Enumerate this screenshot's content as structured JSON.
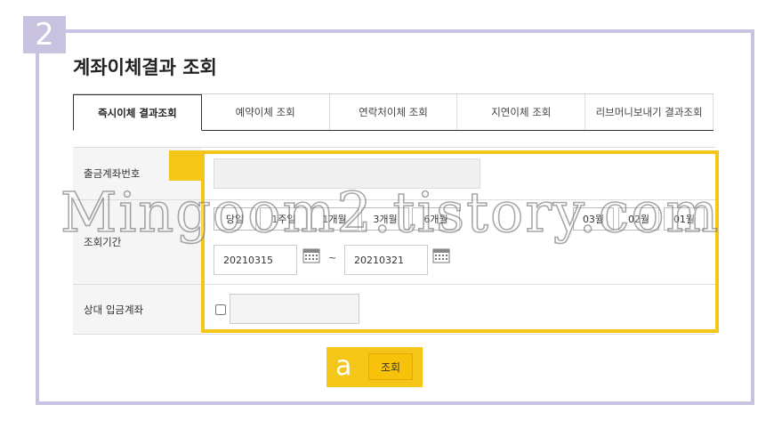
{
  "step": {
    "number": "2",
    "color": "#c9c1e0"
  },
  "title": "계좌이체결과 조회",
  "tabs": [
    {
      "label": "즉시이체 결과조회",
      "active": true
    },
    {
      "label": "예약이체 조회",
      "active": false
    },
    {
      "label": "연락처이체 조회",
      "active": false
    },
    {
      "label": "지연이체 조회",
      "active": false
    },
    {
      "label": "리브머니보내기 결과조회",
      "active": false
    }
  ],
  "form": {
    "account_label": "출금계좌번호",
    "period_label": "조회기간",
    "target_label": "상대 입금계좌",
    "quick_periods": [
      "당일",
      "1주일",
      "1개월",
      "3개월",
      "6개월"
    ],
    "month_buttons": [
      "03월",
      "02월",
      "01월"
    ],
    "start_date": "20210315",
    "end_date": "20210321",
    "tilde": "~",
    "calendar_icon": "calendar-icon"
  },
  "callout": {
    "letter": "a",
    "highlight_color": "#f4c618"
  },
  "search_button": "조회",
  "watermark": "Mingoom2.tistory.com"
}
